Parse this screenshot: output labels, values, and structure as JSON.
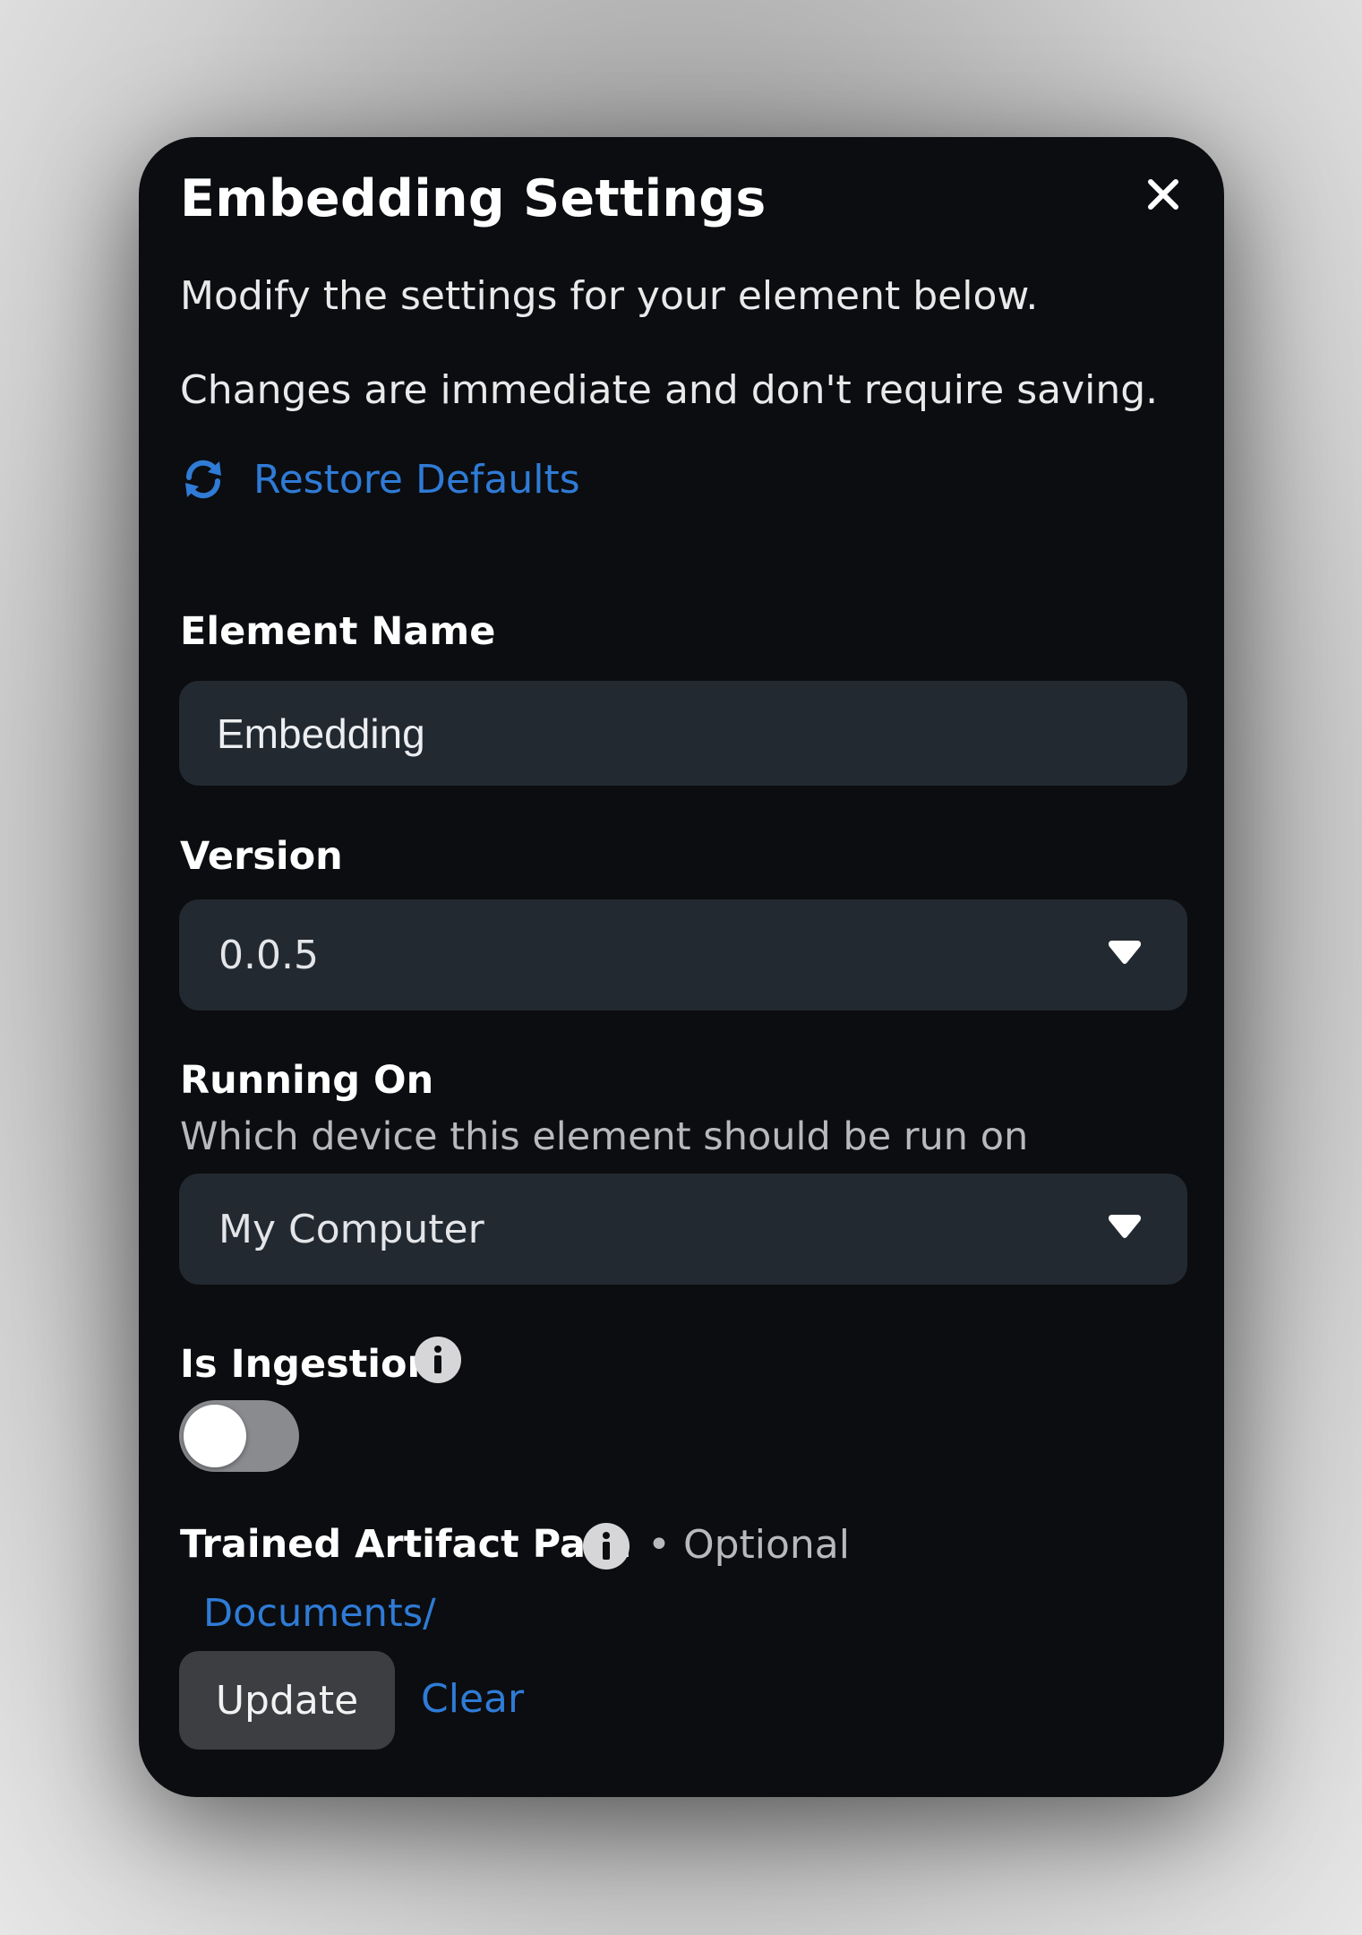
{
  "dialog": {
    "title": "Embedding Settings",
    "description_1": "Modify the settings for your element below.",
    "description_2": "Changes are immediate and don't require saving.",
    "restore_label": "Restore Defaults"
  },
  "fields": {
    "element_name": {
      "label": "Element Name",
      "value": "Embedding"
    },
    "version": {
      "label": "Version",
      "value": "0.0.5"
    },
    "running_on": {
      "label": "Running On",
      "helper": "Which device this element should be run on",
      "value": "My Computer"
    },
    "is_ingestion": {
      "label": "Is Ingestion",
      "enabled": false
    },
    "trained_artifact_path": {
      "label": "Trained Artifact Path",
      "optional": "• Optional",
      "path": "Documents/",
      "update_label": "Update",
      "clear_label": "Clear"
    }
  },
  "icons": {
    "close": "close-icon",
    "restore": "refresh-icon",
    "caret": "caret-down-icon",
    "info": "info-icon"
  },
  "colors": {
    "panel_bg": "#0b0d10",
    "field_bg": "#222931",
    "accent": "#2f7bd6",
    "toggle_off": "#8a8b8e",
    "button_bg": "#3d3e41"
  }
}
